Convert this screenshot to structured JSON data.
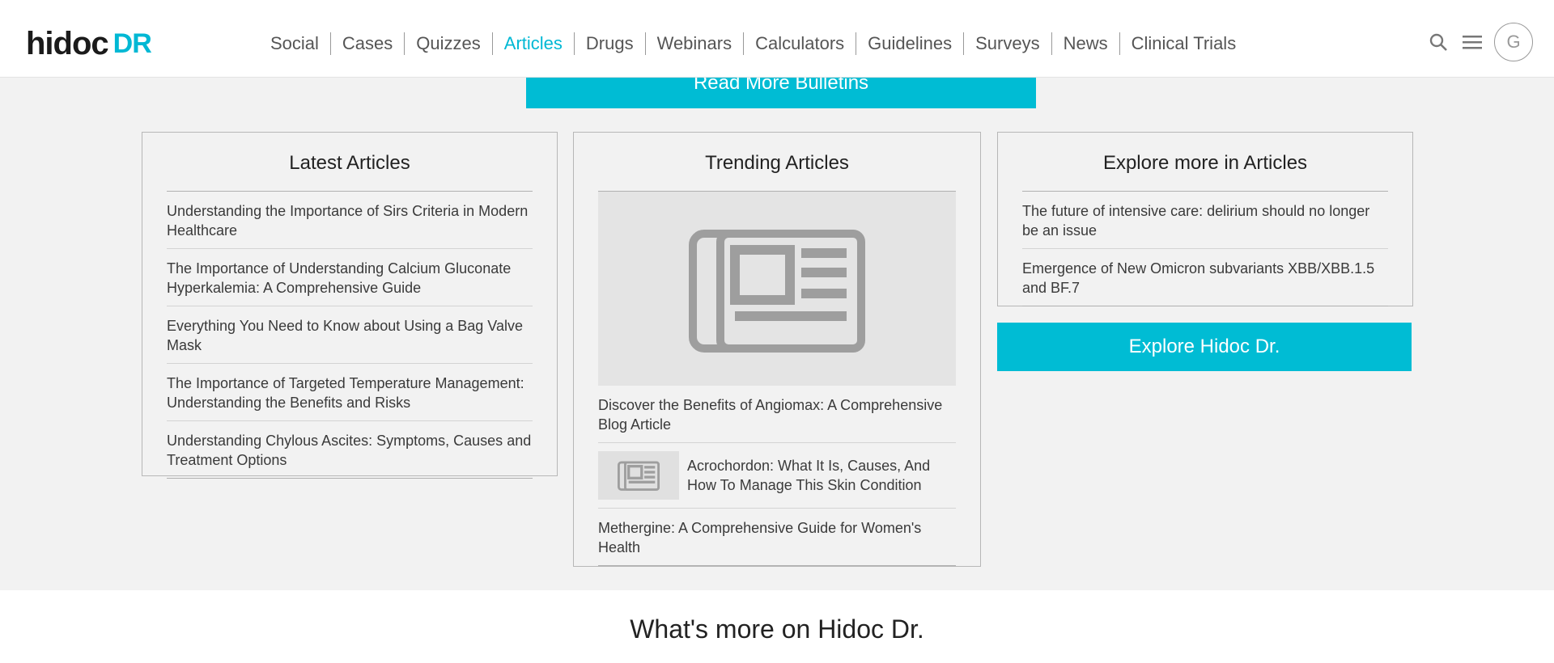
{
  "header": {
    "logo_main": "hidoc",
    "logo_accent": "DR",
    "nav": [
      "Social",
      "Cases",
      "Quizzes",
      "Articles",
      "Drugs",
      "Webinars",
      "Calculators",
      "Guidelines",
      "Surveys",
      "News",
      "Clinical Trials"
    ],
    "active_nav": "Articles",
    "avatar_initial": "G",
    "icons": [
      "search-icon",
      "menu-icon"
    ]
  },
  "bulletin_button": "Read More Bulletins",
  "latest": {
    "title": "Latest Articles",
    "items": [
      "Understanding the Importance of Sirs Criteria in Modern Healthcare",
      "The Importance of Understanding Calcium Gluconate Hyperkalemia: A Comprehensive Guide",
      "Everything You Need to Know about Using a Bag Valve Mask",
      "The Importance of Targeted Temperature Management: Understanding the Benefits and Risks",
      "Understanding Chylous Ascites: Symptoms, Causes and Treatment Options"
    ]
  },
  "trending": {
    "title": "Trending Articles",
    "featured": "Discover the Benefits of Angiomax: A Comprehensive Blog Article",
    "thumb_item": "Acrochordon: What It Is, Causes, And How To Manage This Skin Condition",
    "last_item": "Methergine: A Comprehensive Guide for Women's Health"
  },
  "explore": {
    "title": "Explore more in Articles",
    "items": [
      "The future of intensive care: delirium should no longer be an issue",
      "Emergence of New Omicron subvariants XBB/XBB.1.5 and BF.7"
    ],
    "button": "Explore Hidoc Dr."
  },
  "more_title": "What's more on Hidoc Dr.",
  "colors": {
    "accent": "#00bcd4",
    "band": "#f2f2f2"
  }
}
